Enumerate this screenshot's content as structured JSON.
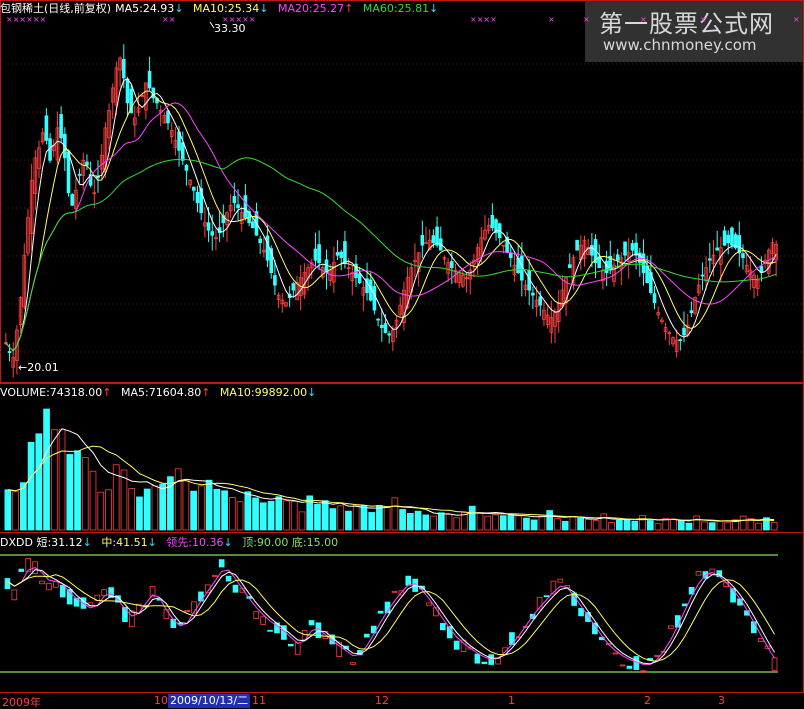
{
  "header": {
    "stock_title": "包钢稀土(日线,前复权)",
    "ma5": "MA5:24.93",
    "ma10": "MA10:25.34",
    "ma20": "MA20:25.27",
    "ma60": "MA60:25.81",
    "up_arrow": "↑",
    "down_arrow": "↓"
  },
  "watermark": {
    "title": "第一股票公式网",
    "url": "www.chnmoney.com"
  },
  "price_panel": {
    "high_label": "33.30",
    "low_label": "←20.01",
    "x_marks": [
      "××××××",
      "××",
      "×××××",
      "××××",
      "×",
      "×",
      "×",
      "×",
      "×"
    ]
  },
  "volume_panel": {
    "volume": "VOLUME:74318.00",
    "ma5": "MA5:71604.80",
    "ma10": "MA10:99892.00"
  },
  "dxdd_panel": {
    "name": "DXDD",
    "short": "短:31.12",
    "mid": "中:41.51",
    "lead": "领先:10.36",
    "top": "顶:90.00",
    "bottom": "底:15.00"
  },
  "x_axis": {
    "labels": [
      "2009年",
      "10",
      "2009/10/13/二",
      "11",
      "12",
      "1",
      "2",
      "3"
    ]
  },
  "colors": {
    "up_candle": "#ff4040",
    "down_candle": "#33ffff",
    "ma5": "#ffffff",
    "ma10": "#ffff66",
    "ma20": "#ff44ff",
    "ma60": "#33dd33",
    "frame": "#c01818"
  },
  "chart_data": {
    "type": "candlestick",
    "price_range": [
      19.5,
      34.0
    ],
    "marked_high": 33.3,
    "marked_low": 20.01,
    "ma_latest": {
      "MA5": 24.93,
      "MA10": 25.34,
      "MA20": 25.27,
      "MA60": 25.81
    },
    "volume_latest": {
      "VOLUME": 74318.0,
      "MA5": 71604.8,
      "MA10": 99892.0
    },
    "dxdd_latest": {
      "短": 31.12,
      "中": 41.51,
      "领先": 10.36,
      "顶": 90.0,
      "底": 15.0
    },
    "dxdd_range": [
      0,
      100
    ],
    "close_path": [
      21.0,
      20.6,
      20.4,
      21.5,
      22.8,
      24.5,
      26.0,
      27.5,
      28.4,
      28.8,
      29.4,
      29.1,
      28.3,
      28.9,
      29.6,
      29.2,
      28.4,
      27.0,
      26.5,
      27.1,
      27.7,
      28.3,
      28.1,
      27.3,
      27.0,
      27.6,
      28.5,
      29.6,
      30.3,
      31.2,
      32.0,
      32.4,
      31.6,
      30.6,
      30.2,
      30.0,
      30.4,
      30.9,
      31.4,
      31.2,
      30.8,
      30.6,
      30.3,
      30.1,
      29.8,
      29.5,
      29.1,
      28.7,
      28.3,
      27.9,
      27.5,
      27.1,
      26.6,
      26.2,
      25.8,
      25.5,
      25.3,
      25.2,
      25.4,
      25.8,
      26.2,
      26.5,
      26.6,
      26.4,
      26.2,
      26.0,
      25.8,
      25.6,
      25.3,
      25.0,
      24.7,
      24.3,
      23.8,
      23.3,
      22.9,
      22.7,
      22.6,
      22.8,
      23.1,
      23.4,
      23.6,
      23.8,
      24.0,
      24.2,
      24.3,
      24.2,
      24.0,
      23.8,
      23.9,
      24.2,
      24.5,
      24.4,
      24.2,
      24.0,
      23.8,
      23.6,
      23.4,
      23.2,
      23.0,
      22.7,
      22.3,
      21.9,
      21.6,
      21.4,
      21.3,
      21.5,
      21.9,
      22.5,
      23.1,
      23.6,
      24.0,
      24.3,
      24.6,
      24.9,
      25.0,
      25.1,
      25.0,
      24.9,
      24.7,
      24.4,
      24.2,
      24.0,
      23.9,
      23.8,
      23.7,
      23.6,
      23.9,
      24.3,
      24.8,
      25.2,
      25.5,
      25.7,
      25.6,
      25.4,
      25.2,
      24.9,
      24.6,
      24.4,
      24.1,
      23.8,
      23.5,
      23.3,
      23.1,
      22.9,
      22.7,
      22.5,
      22.3,
      22.1,
      22.0,
      22.2,
      22.6,
      23.1,
      23.6,
      24.0,
      24.4,
      24.7,
      24.9,
      25.1,
      24.8,
      24.5,
      24.2,
      24.0,
      23.9,
      23.8,
      23.9,
      24.1,
      24.3,
      24.4,
      24.5,
      24.6,
      24.7,
      24.5,
      24.2,
      23.8,
      23.4,
      23.0,
      22.6,
      22.2,
      21.9,
      21.6,
      21.4,
      21.2,
      21.1,
      21.1,
      21.3,
      21.7,
      22.2,
      22.8,
      23.3,
      23.7,
      24.0,
      24.3,
      24.5,
      24.7,
      24.8,
      24.9,
      25.0,
      24.9,
      24.8,
      24.6,
      24.4,
      24.1,
      23.9,
      23.7,
      23.5,
      23.8,
      24.3,
      24.7,
      25.0,
      24.93
    ],
    "volume_profile": [
      2.2,
      1.8,
      2.8,
      3.6,
      4.2,
      6.4,
      4.9,
      5.3,
      4.6,
      4.0,
      3.2,
      2.6,
      2.4,
      2.3,
      3.1,
      2.8,
      2.5,
      2.2,
      2.0,
      1.9,
      2.6,
      3.3,
      2.9,
      2.2,
      1.8,
      1.9,
      2.2,
      2.0,
      1.7,
      1.5,
      1.8,
      1.6,
      1.4,
      1.3,
      1.5,
      1.7,
      1.5,
      1.3,
      1.2,
      1.4,
      1.6,
      1.3,
      1.1,
      1.0,
      1.2,
      1.4,
      1.2,
      1.0,
      1.1,
      1.3,
      1.5,
      1.2,
      0.9,
      0.9,
      1.0,
      0.8,
      0.9,
      0.8,
      0.7,
      0.9,
      1.0,
      0.8,
      0.9,
      0.7,
      0.6,
      0.8,
      0.9,
      0.7,
      0.6,
      0.7,
      0.8,
      0.6,
      0.5,
      0.7,
      0.6,
      0.5,
      0.6,
      0.7,
      0.5,
      0.6,
      0.5,
      0.4,
      0.6,
      0.5,
      0.4,
      0.5,
      0.6,
      0.5,
      0.4,
      0.6,
      0.5,
      0.4,
      0.5,
      0.4,
      0.5,
      0.6,
      0.5,
      0.4,
      0.5,
      0.4
    ],
    "dxdd_profile": [
      78,
      70,
      84,
      90,
      88,
      82,
      76,
      80,
      72,
      66,
      62,
      58,
      55,
      62,
      70,
      66,
      60,
      52,
      48,
      56,
      64,
      70,
      60,
      50,
      44,
      40,
      48,
      58,
      66,
      74,
      82,
      90,
      84,
      76,
      68,
      60,
      54,
      48,
      44,
      40,
      36,
      30,
      26,
      34,
      42,
      38,
      32,
      28,
      24,
      20,
      16,
      22,
      30,
      40,
      50,
      58,
      66,
      72,
      78,
      74,
      68,
      60,
      52,
      44,
      36,
      30,
      26,
      22,
      18,
      16,
      14,
      18,
      24,
      30,
      38,
      46,
      54,
      60,
      66,
      72,
      76,
      70,
      62,
      54,
      46,
      38,
      30,
      24,
      20,
      16,
      14,
      12,
      10,
      12,
      18,
      26,
      36,
      48,
      60,
      72,
      80,
      86,
      84,
      80,
      74,
      68,
      60,
      50,
      40,
      30,
      20,
      12
    ]
  }
}
